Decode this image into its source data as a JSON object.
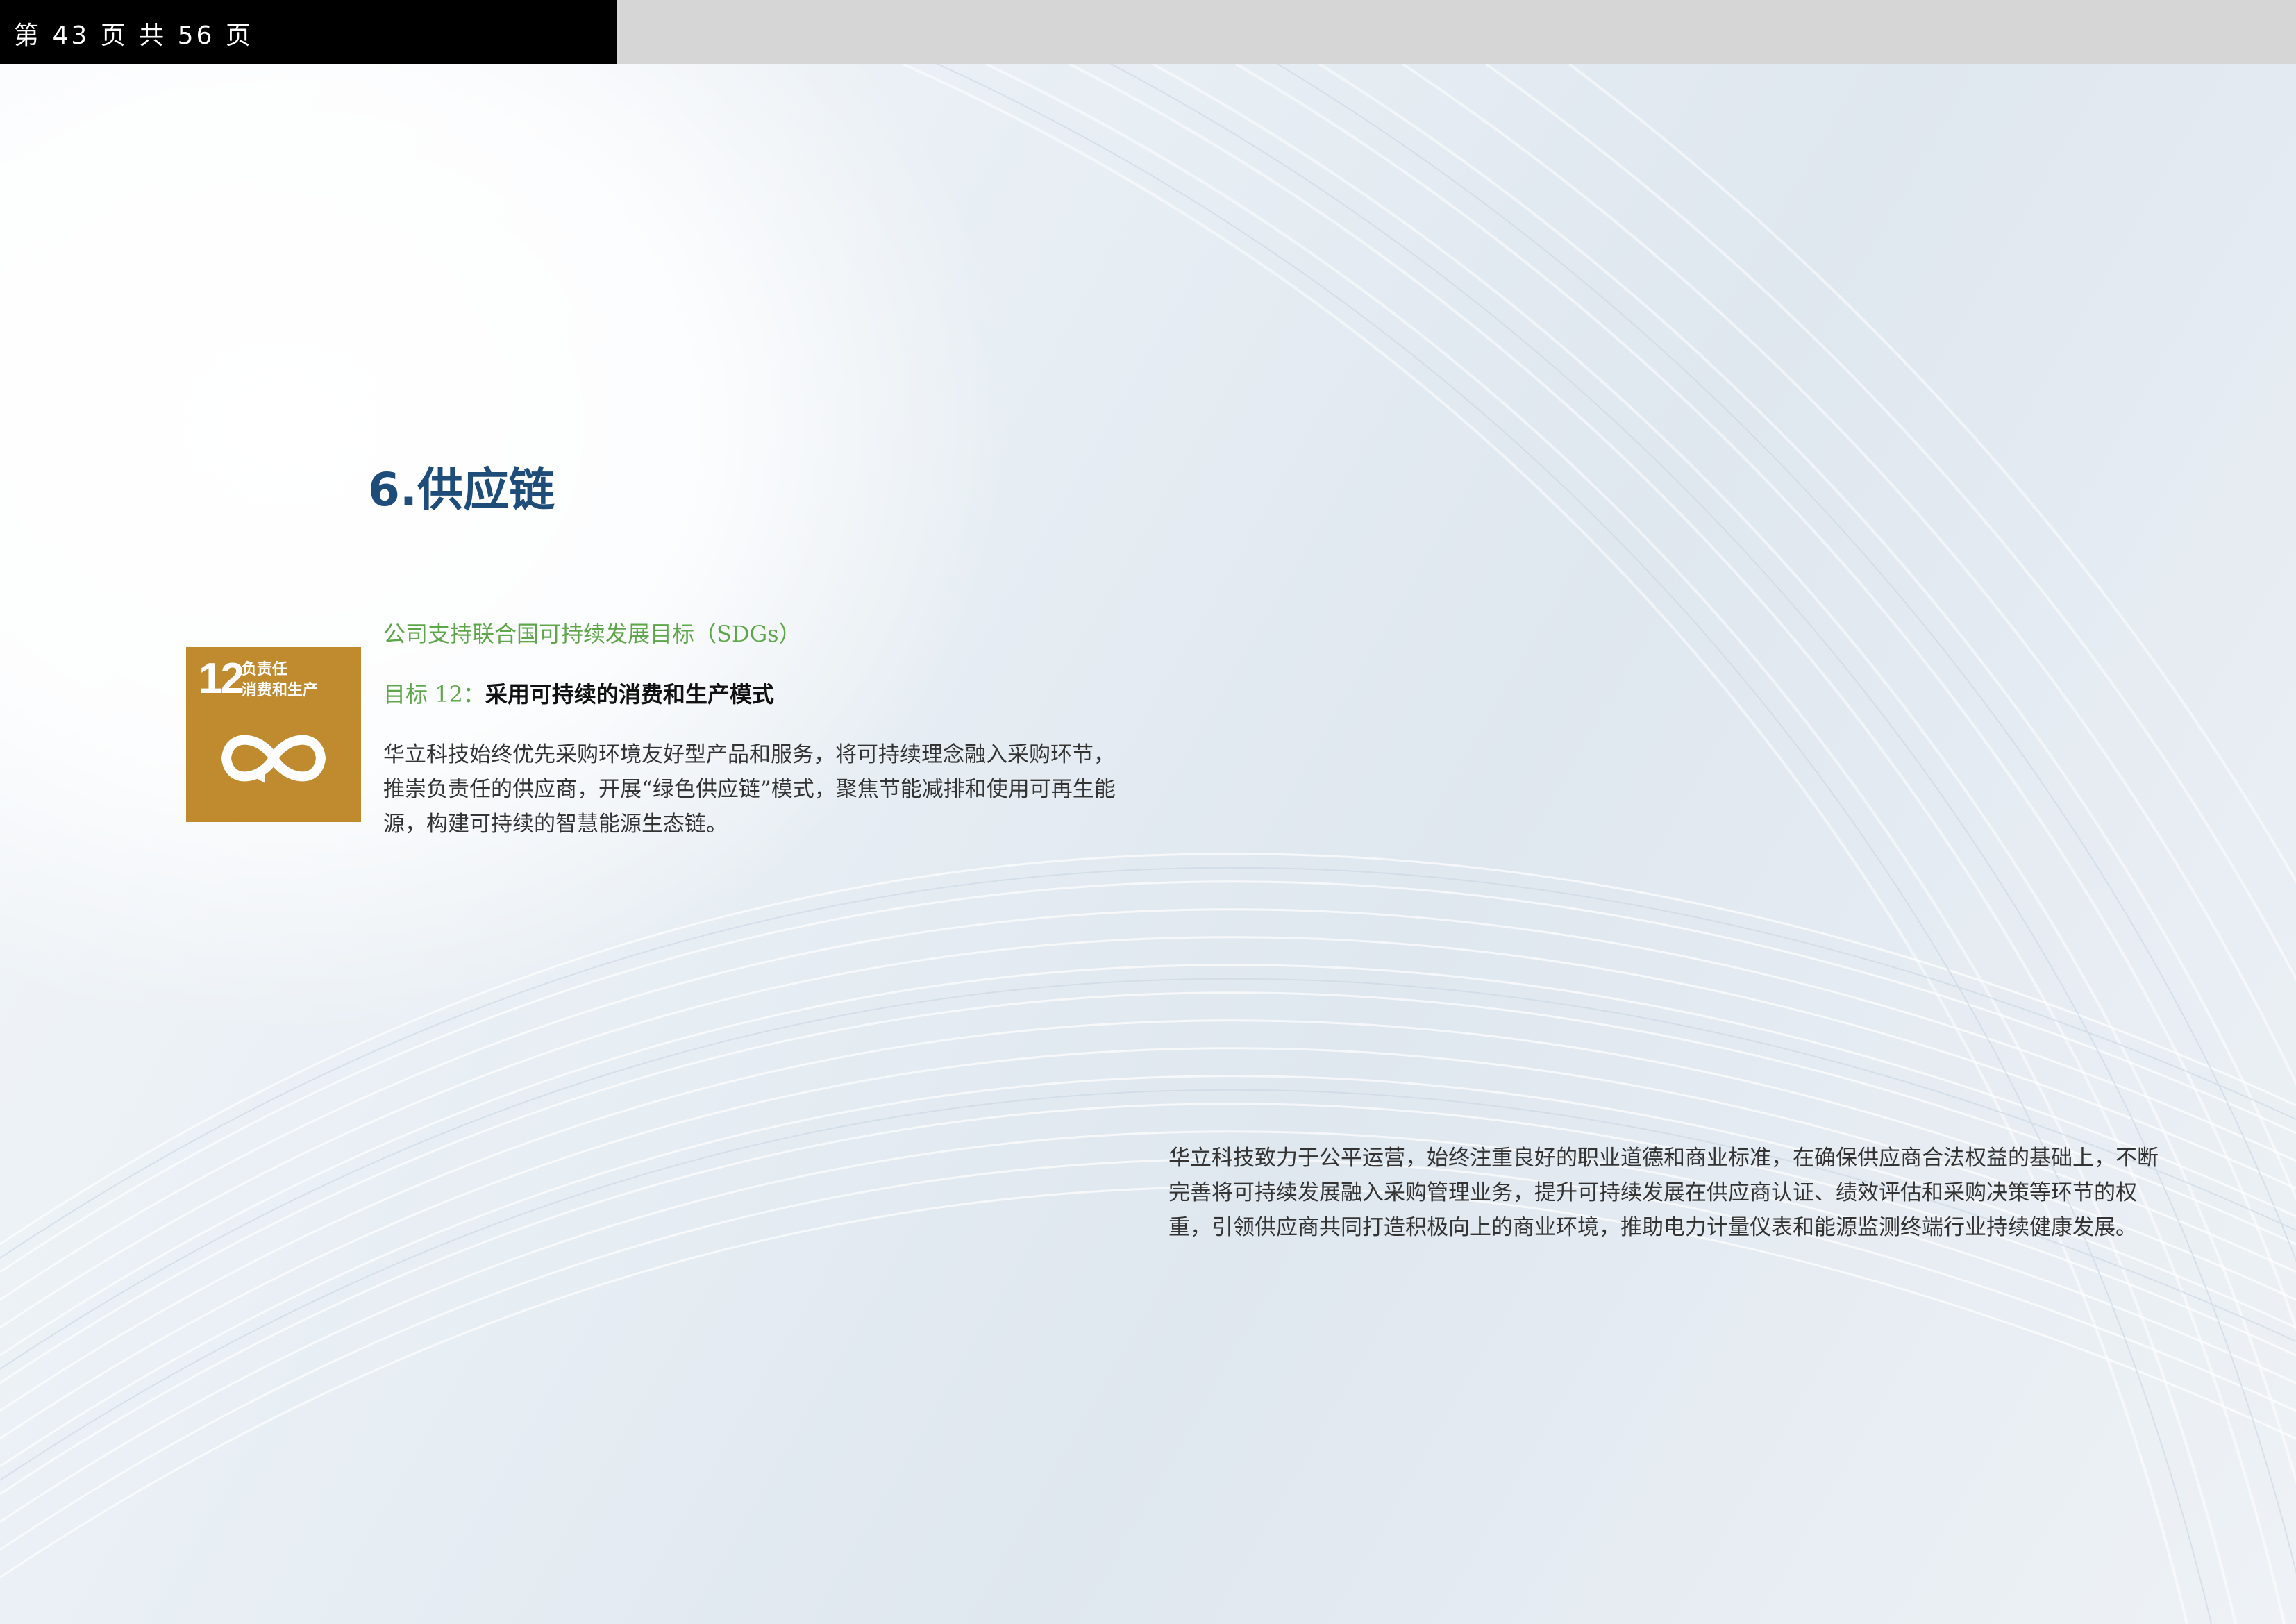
{
  "header": {
    "page_counter": "第 43 页 共 56 页"
  },
  "section": {
    "title": "6.供应链"
  },
  "sdg": {
    "tile_number": "12",
    "tile_label_line1": "负责任",
    "tile_label_line2": "消费和生产",
    "tile_color": "#bf8b2e",
    "tile_icon": "infinity-arrow-icon",
    "support_text": "公司支持联合国可持续发展目标（SDGs）",
    "goal_prefix": "目标 12：",
    "goal_title": "采用可持续的消费和生产模式",
    "intro_text": "华立科技始终优先采购环境友好型产品和服务，将可持续理念融入采购环节，推崇负责任的供应商，开展“绿色供应链”模式，聚焦节能减排和使用可再生能源，构建可持续的智慧能源生态链。"
  },
  "body": {
    "main_text": "华立科技致力于公平运营，始终注重良好的职业道德和商业标准，在确保供应商合法权益的基础上，不断完善将可持续发展融入采购管理业务，提升可持续发展在供应商认证、绩效评估和采购决策等环节的权重，引领供应商共同打造积极向上的商业环境，推助电力计量仪表和能源监测终端行业持续健康发展。"
  },
  "colors": {
    "title_blue": "#1f4d7a",
    "accent_green": "#5ea64a",
    "header_black": "#000000",
    "header_gray": "#d6d6d6"
  }
}
